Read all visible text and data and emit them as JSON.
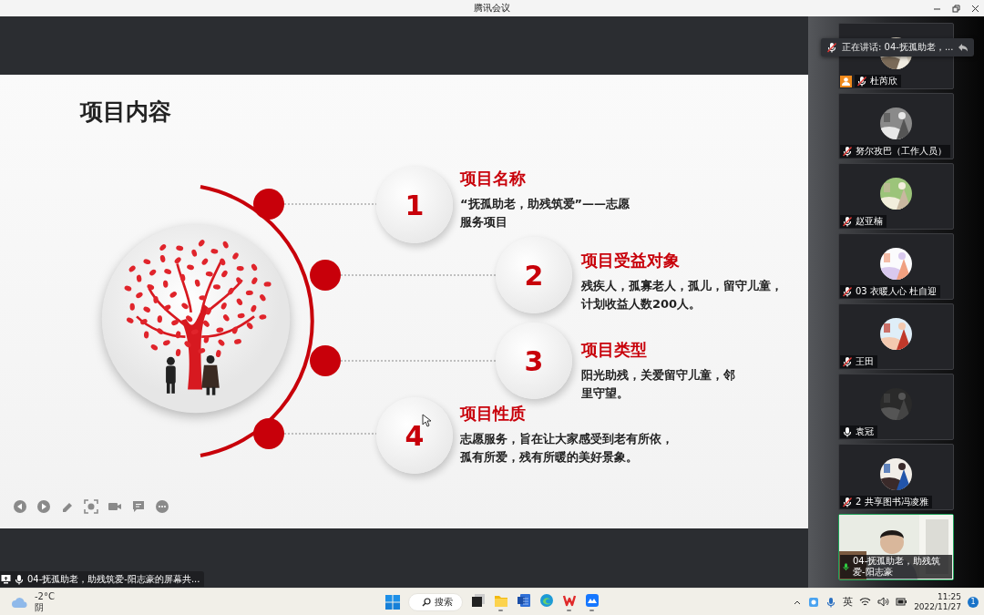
{
  "window": {
    "title": "腾讯会议"
  },
  "slide": {
    "title": "项目内容",
    "items": [
      {
        "number": "1",
        "heading": "项目名称",
        "lines": [
          "“抚孤助老，助残筑爱”——志愿",
          "服务项目"
        ]
      },
      {
        "number": "2",
        "heading": "项目受益对象",
        "lines": [
          "残疾人，孤寡老人，孤儿，留守儿童，",
          "计划收益人数200人。"
        ]
      },
      {
        "number": "3",
        "heading": "项目类型",
        "lines": [
          "阳光助残，关爱留守儿童，邻",
          "里守望。"
        ]
      },
      {
        "number": "4",
        "heading": "项目性质",
        "lines": [
          "志愿服务，旨在让大家感受到老有所依，",
          "孤有所爱，残有所暖的美好景象。"
        ]
      }
    ]
  },
  "share_banner": {
    "text": "04-抚孤助老，助残筑爱-阳志豪的屏幕共..."
  },
  "speaker_popup": {
    "text": "正在讲话: 04-抚孤助老，..."
  },
  "participants": [
    {
      "name": "杜芮欣",
      "muted": true,
      "host": true,
      "video": false,
      "speaking": false
    },
    {
      "name": "努尔孜巴（工作人员）",
      "muted": true,
      "host": false,
      "video": false,
      "speaking": false
    },
    {
      "name": "赵亚楠",
      "muted": true,
      "host": false,
      "video": false,
      "speaking": false
    },
    {
      "name": "03 衣暖人心 杜自迎",
      "muted": true,
      "host": false,
      "video": false,
      "speaking": false
    },
    {
      "name": "王田",
      "muted": true,
      "host": false,
      "video": false,
      "speaking": false
    },
    {
      "name": "袁冠",
      "muted": false,
      "host": false,
      "video": false,
      "speaking": false
    },
    {
      "name": "2 共享图书冯凌雅",
      "muted": true,
      "host": false,
      "video": false,
      "speaking": false
    },
    {
      "name": "04-抚孤助老，助残筑爱-阳志豪",
      "muted": false,
      "host": false,
      "video": true,
      "speaking": true
    }
  ],
  "taskbar": {
    "weather": {
      "temperature": "-2°C",
      "condition": "阴"
    },
    "search": {
      "label": "搜索"
    },
    "apps": [
      {
        "kind": "taskview",
        "running": false
      },
      {
        "kind": "folder",
        "running": true
      },
      {
        "kind": "word",
        "running": false
      },
      {
        "kind": "edge",
        "running": false
      },
      {
        "kind": "wps",
        "running": true
      },
      {
        "kind": "meeting",
        "running": true
      }
    ],
    "tray": {
      "input_method": "英",
      "time": "11:25",
      "date": "2022/11/27",
      "notifications": "1"
    }
  }
}
